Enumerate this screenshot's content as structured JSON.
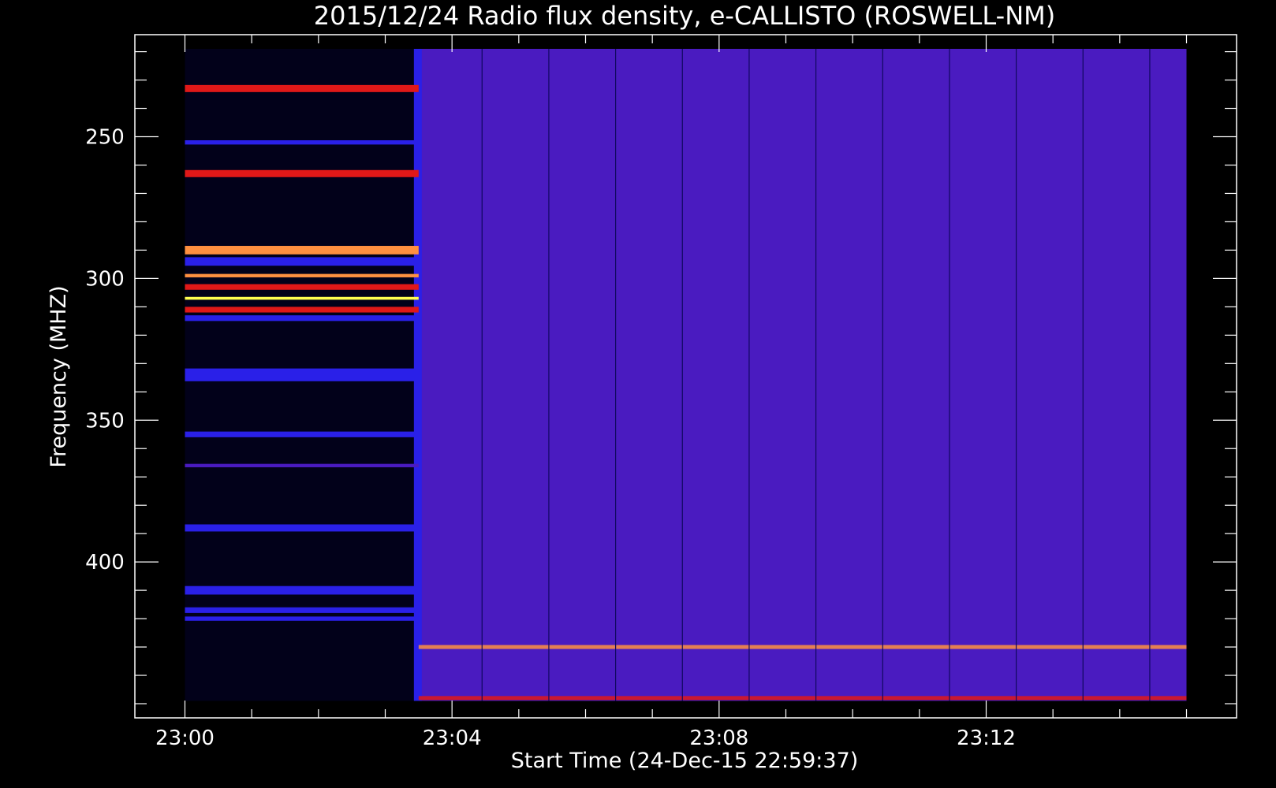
{
  "chart_data": {
    "type": "heatmap",
    "title": "2015/12/24  Radio flux density, e-CALLISTO (ROSWELL-NM)",
    "xlabel": "Start Time (24-Dec-15 22:59:37)",
    "ylabel": "Frequency (MHZ)",
    "x_ticks": [
      "23:00",
      "23:04",
      "23:08",
      "23:12"
    ],
    "x_tick_minutes": [
      0,
      4,
      8,
      12
    ],
    "y_ticks": [
      250,
      300,
      350,
      400
    ],
    "xlim_minutes": [
      -0.75,
      15.75
    ],
    "ylim_mhz": [
      214,
      455
    ],
    "y_inverted": true,
    "data_range_minutes": [
      0,
      15
    ],
    "data_range_mhz": [
      219,
      449
    ],
    "background_level": "purple",
    "startup_end_minute": 3.5,
    "colors": {
      "background": "#000000",
      "frame": "#ffffff",
      "blue": "#2a20e8",
      "purple": "#4a1bc0",
      "red": "#e01818",
      "orange": "#ff9040",
      "yellow": "#ffff50"
    },
    "startup_bands": [
      {
        "mhz": 233,
        "width": 2.5,
        "level": "red"
      },
      {
        "mhz": 252,
        "width": 1.5,
        "level": "blue"
      },
      {
        "mhz": 263,
        "width": 2.5,
        "level": "red"
      },
      {
        "mhz": 290,
        "width": 3.0,
        "level": "orange"
      },
      {
        "mhz": 294,
        "width": 3.0,
        "level": "blue"
      },
      {
        "mhz": 299,
        "width": 1.2,
        "level": "orange"
      },
      {
        "mhz": 303,
        "width": 2.0,
        "level": "red"
      },
      {
        "mhz": 307,
        "width": 1.0,
        "level": "yellow"
      },
      {
        "mhz": 311,
        "width": 2.0,
        "level": "red"
      },
      {
        "mhz": 314,
        "width": 2.0,
        "level": "blue"
      },
      {
        "mhz": 334,
        "width": 4.5,
        "level": "blue"
      },
      {
        "mhz": 355,
        "width": 2.0,
        "level": "blue"
      },
      {
        "mhz": 366,
        "width": 1.2,
        "level": "purple"
      },
      {
        "mhz": 388,
        "width": 2.5,
        "level": "blue"
      },
      {
        "mhz": 410,
        "width": 3.0,
        "level": "blue"
      },
      {
        "mhz": 417,
        "width": 2.0,
        "level": "blue"
      },
      {
        "mhz": 420,
        "width": 1.5,
        "level": "blue"
      }
    ],
    "interference_lines": [
      {
        "mhz": 430,
        "level": "orange"
      },
      {
        "mhz": 448,
        "level": "red"
      }
    ],
    "dropout_columns_minutes": [
      4.45,
      5.45,
      6.45,
      7.45,
      8.45,
      9.45,
      10.45,
      11.45,
      12.45,
      13.45,
      14.45
    ]
  }
}
